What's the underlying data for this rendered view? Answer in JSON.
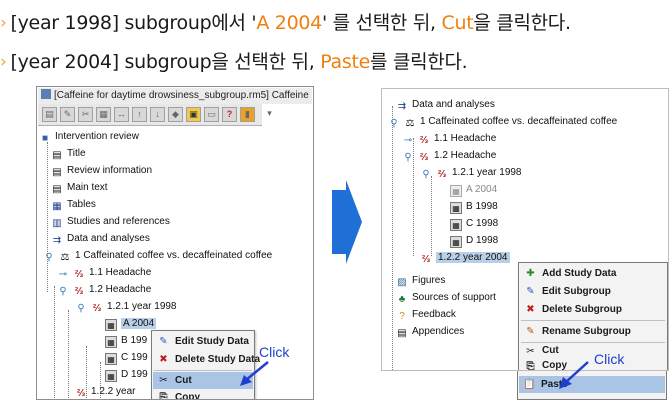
{
  "instructions": {
    "step1": {
      "arrow": "›",
      "pre": "[year 1998] subgroup에서 '",
      "highlight1": "A 2004",
      "mid": "' 를 선택한 뒤, ",
      "highlight2": "Cut",
      "post": "을 클릭한다."
    },
    "step2": {
      "arrow": "›",
      "pre": "[year 2004] subgroup을 선택한 뒤, ",
      "highlight": "Paste",
      "post": "를 클릭한다."
    }
  },
  "left_panel": {
    "title": "[Caffeine for daytime drowsiness_subgroup.rm5] Caffeine",
    "tree": {
      "intervention_review": "Intervention review",
      "title": "Title",
      "review_information": "Review information",
      "main_text": "Main text",
      "tables": "Tables",
      "studies_and_references": "Studies and references",
      "data_and_analyses": "Data and analyses",
      "comparison_1": "1 Caffeinated coffee vs. decaffeinated coffee",
      "outcome_1_1": "1.1 Headache",
      "outcome_1_2": "1.2 Headache",
      "subgroup_1998": "1.2.1 year 1998",
      "study_a": "A 2004",
      "study_b": "B 199",
      "study_c": "C 199",
      "study_d": "D 199",
      "subgroup_2004": "1.2.2 year"
    },
    "context_menu": {
      "edit_study_data": "Edit Study Data",
      "delete_study_data": "Delete Study Data",
      "cut": "Cut",
      "copy": "Copy"
    },
    "click_label": "Click"
  },
  "right_panel": {
    "tree": {
      "data_and_analyses": "Data and analyses",
      "comparison_1": "1 Caffeinated coffee vs. decaffeinated coffee",
      "outcome_1_1": "1.1 Headache",
      "outcome_1_2": "1.2 Headache",
      "subgroup_1998": "1.2.1 year 1998",
      "study_a": "A 2004",
      "study_b": "B 1998",
      "study_c": "C 1998",
      "study_d": "D 1998",
      "subgroup_2004": "1.2.2 year 2004",
      "figures": "Figures",
      "sources_of_support": "Sources of support",
      "feedback": "Feedback",
      "appendices": "Appendices"
    },
    "context_menu": {
      "add_study_data": "Add Study Data",
      "edit_subgroup": "Edit Subgroup",
      "delete_subgroup": "Delete Subgroup",
      "rename_subgroup": "Rename Subgroup",
      "cut": "Cut",
      "copy": "Copy",
      "paste": "Paste"
    },
    "click_label": "Click"
  },
  "colors": {
    "highlight": "#f07f10",
    "arrow_accent": "#f4a23a",
    "big_arrow": "#1f6fd6",
    "click_text": "#1f3fcf"
  }
}
